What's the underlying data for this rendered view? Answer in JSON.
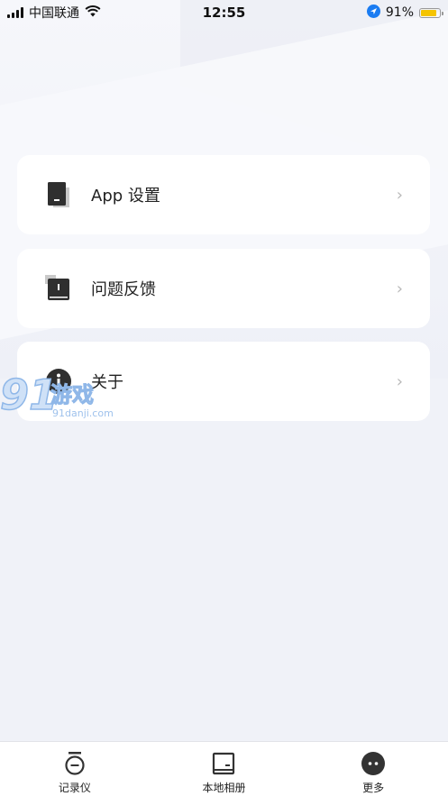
{
  "status_bar": {
    "carrier": "中国联通",
    "time": "12:55",
    "battery_percent": "91%",
    "battery_level": 0.91,
    "battery_color": "#f5c400"
  },
  "menu": [
    {
      "label": "App 设置",
      "icon": "phone-settings-icon"
    },
    {
      "label": "问题反馈",
      "icon": "feedback-icon"
    },
    {
      "label": "关于",
      "icon": "info-icon"
    }
  ],
  "watermark": {
    "logo_text": "91游戏",
    "url": "91danji.com"
  },
  "tab_bar": {
    "items": [
      {
        "label": "记录仪",
        "icon": "recorder-icon"
      },
      {
        "label": "本地相册",
        "icon": "album-icon"
      },
      {
        "label": "更多",
        "icon": "more-icon"
      }
    ]
  },
  "colors": {
    "accent": "#333333",
    "background": "#f0f2f8",
    "card": "#ffffff"
  }
}
